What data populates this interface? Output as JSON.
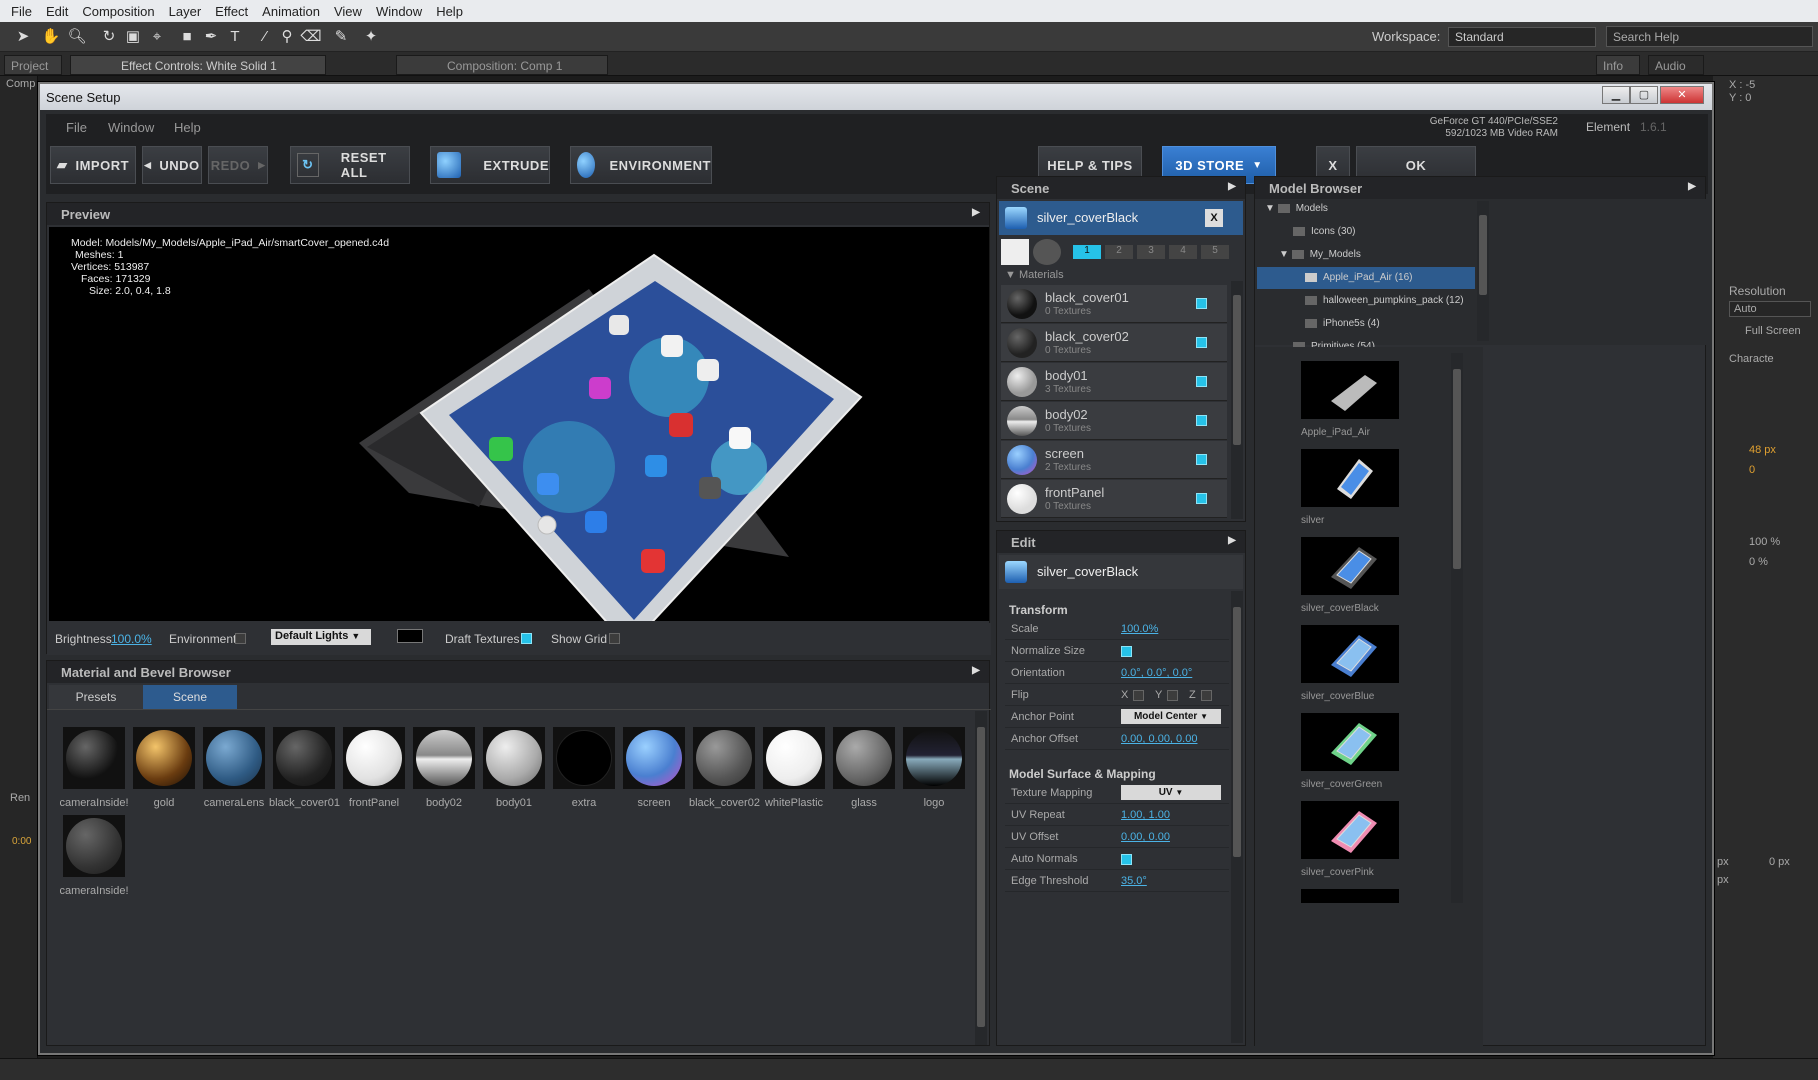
{
  "host": {
    "menu": [
      "File",
      "Edit",
      "Composition",
      "Layer",
      "Effect",
      "Animation",
      "View",
      "Window",
      "Help"
    ],
    "workspace_label": "Workspace:",
    "workspace_value": "Standard",
    "search_placeholder": "Search Help",
    "tabs": {
      "project": "Project",
      "effect_controls": "Effect Controls: White Solid 1",
      "composition": "Composition: Comp 1",
      "info": "Info",
      "audio": "Audio"
    },
    "info_x": "X : -5",
    "info_y": "Y : 0",
    "left_comp": "Comp",
    "left_ren": "Ren",
    "left_time": "0:00",
    "right_panel": {
      "resolution_label": "Resolution",
      "resolution_value": "Auto",
      "full_screen": "Full Screen",
      "character_tab": "Characte",
      "font_size": "48 px",
      "tracking": "0",
      "vscale": "100 %",
      "baseline": "0 %",
      "indent": "0 px",
      "px": "px",
      "px2": "px"
    }
  },
  "dialog": {
    "title": "Scene Setup",
    "menu": [
      "File",
      "Window",
      "Help"
    ],
    "gpu_line1": "GeForce GT 440/PCIe/SSE2",
    "gpu_line2": "592/1023 MB Video RAM",
    "element_label": "Element",
    "element_version": "1.6.1",
    "toolbar": {
      "import": "IMPORT",
      "undo": "UNDO",
      "redo": "REDO",
      "reset_all": "RESET ALL",
      "extrude": "EXTRUDE",
      "environment": "ENVIRONMENT",
      "help_tips": "HELP & TIPS",
      "store": "3D STORE",
      "close": "X",
      "ok": "OK"
    }
  },
  "preview": {
    "title": "Preview",
    "info_labels": [
      "Model:",
      "Meshes:",
      "Vertices:",
      "Faces:",
      "Size:"
    ],
    "info_values": [
      "Models/My_Models/Apple_iPad_Air/smartCover_opened.c4d",
      "1",
      "513987",
      "171329",
      "2.0, 0.4, 1.8"
    ],
    "brightness_label": "Brightness",
    "brightness_value": "100.0%",
    "environment_label": "Environment",
    "lights_value": "Default Lights",
    "draft_textures_label": "Draft Textures",
    "show_grid_label": "Show Grid"
  },
  "material_browser": {
    "title": "Material and Bevel Browser",
    "tabs": [
      "Presets",
      "Scene"
    ],
    "materials": [
      "cameraInside!",
      "gold",
      "cameraLens",
      "black_cover01",
      "frontPanel",
      "body02",
      "body01",
      "extra",
      "screen",
      "black_cover02",
      "whitePlastic",
      "glass",
      "logo",
      "cameraInside!"
    ]
  },
  "scene": {
    "title": "Scene",
    "object_name": "silver_coverBlack",
    "layer_tabs": [
      "1",
      "2",
      "3",
      "4",
      "5"
    ],
    "materials_header": "Materials",
    "materials": [
      {
        "name": "black_cover01",
        "textures": "0 Textures"
      },
      {
        "name": "black_cover02",
        "textures": "0 Textures"
      },
      {
        "name": "body01",
        "textures": "3 Textures"
      },
      {
        "name": "body02",
        "textures": "0 Textures"
      },
      {
        "name": "screen",
        "textures": "2 Textures"
      },
      {
        "name": "frontPanel",
        "textures": "0 Textures"
      }
    ]
  },
  "edit": {
    "title": "Edit",
    "object_name": "silver_coverBlack",
    "transform_header": "Transform",
    "scale_label": "Scale",
    "scale_value": "100.0%",
    "normalize_label": "Normalize Size",
    "orientation_label": "Orientation",
    "orientation_value": "0.0°, 0.0°, 0.0°",
    "flip_label": "Flip",
    "flip_x": "X",
    "flip_y": "Y",
    "flip_z": "Z",
    "anchor_point_label": "Anchor Point",
    "anchor_point_value": "Model Center",
    "anchor_offset_label": "Anchor Offset",
    "anchor_offset_value": "0.00, 0.00, 0.00",
    "surface_header": "Model Surface & Mapping",
    "texture_mapping_label": "Texture Mapping",
    "texture_mapping_value": "UV",
    "uv_repeat_label": "UV Repeat",
    "uv_repeat_value": "1.00, 1.00",
    "uv_offset_label": "UV Offset",
    "uv_offset_value": "0.00, 0.00",
    "auto_normals_label": "Auto Normals",
    "edge_threshold_label": "Edge Threshold",
    "edge_threshold_value": "35.0°"
  },
  "model_browser": {
    "title": "Model Browser",
    "tree": [
      "Models",
      "Icons (30)",
      "My_Models",
      "Apple_iPad_Air (16)",
      "halloween_pumpkins_pack (12)",
      "iPhone5s (4)",
      "Primitives (54)"
    ],
    "thumbs": [
      "Apple_iPad_Air",
      "silver",
      "silver_coverBlack",
      "silver_coverBlue",
      "silver_coverGreen",
      "silver_coverPink"
    ]
  },
  "colors": {
    "accent": "#26c2e8",
    "store_blue": "#2a6fc2",
    "link": "#4bb3e6"
  }
}
